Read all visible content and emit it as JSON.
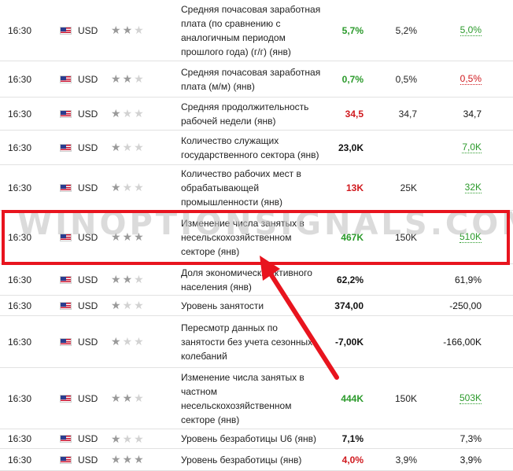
{
  "watermark": "WINOPTIONSIGNALS.COM",
  "colors": {
    "positive": "#2b9a2b",
    "negative": "#d0191e",
    "highlight": "#e8141e"
  },
  "rows": [
    {
      "time": "16:30",
      "currency": "USD",
      "stars": 2,
      "event": "Средняя почасовая заработная плата (по сравнению с аналогичным периодом прошлого года) (г/г) (янв)",
      "actual": "5,7%",
      "actual_color": "green",
      "forecast": "5,2%",
      "previous": "5,0%",
      "previous_color": "green",
      "previous_dotted": true
    },
    {
      "time": "16:30",
      "currency": "USD",
      "stars": 2,
      "event": "Средняя почасовая заработная плата (м/м) (янв)",
      "actual": "0,7%",
      "actual_color": "green",
      "forecast": "0,5%",
      "previous": "0,5%",
      "previous_color": "red",
      "previous_dotted": true
    },
    {
      "time": "16:30",
      "currency": "USD",
      "stars": 1,
      "event": "Средняя продолжительность рабочей недели (янв)",
      "actual": "34,5",
      "actual_color": "red",
      "forecast": "34,7",
      "previous": "34,7",
      "previous_color": "black",
      "previous_dotted": false
    },
    {
      "time": "16:30",
      "currency": "USD",
      "stars": 1,
      "event": "Количество служащих государственного сектора (янв)",
      "actual": "23,0K",
      "actual_color": "black",
      "forecast": "",
      "previous": "7,0K",
      "previous_color": "green",
      "previous_dotted": true
    },
    {
      "time": "16:30",
      "currency": "USD",
      "stars": 1,
      "event": "Количество рабочих мест в обрабатывающей промышленности (янв)",
      "actual": "13K",
      "actual_color": "red",
      "forecast": "25K",
      "previous": "32K",
      "previous_color": "green",
      "previous_dotted": true
    },
    {
      "time": "16:30",
      "currency": "USD",
      "stars": 3,
      "event": "Изменение числа занятых в несельскохозяйственном секторе (янв)",
      "actual": "467K",
      "actual_color": "green",
      "forecast": "150K",
      "previous": "510K",
      "previous_color": "green",
      "previous_dotted": true
    },
    {
      "time": "16:30",
      "currency": "USD",
      "stars": 2,
      "event": "Доля экономически активного населения (янв)",
      "actual": "62,2%",
      "actual_color": "black",
      "forecast": "",
      "previous": "61,9%",
      "previous_color": "black",
      "previous_dotted": false
    },
    {
      "time": "16:30",
      "currency": "USD",
      "stars": 1,
      "event": "Уровень занятости",
      "actual": "374,00",
      "actual_color": "black",
      "forecast": "",
      "previous": "-250,00",
      "previous_color": "black",
      "previous_dotted": false
    },
    {
      "time": "16:30",
      "currency": "USD",
      "stars": 1,
      "event": "Пересмотр данных по занятости без учета сезонных колебаний",
      "actual": "-7,00K",
      "actual_color": "black",
      "forecast": "",
      "previous": "-166,00K",
      "previous_color": "black",
      "previous_dotted": false
    },
    {
      "time": "16:30",
      "currency": "USD",
      "stars": 2,
      "event": "Изменение числа занятых в частном несельскохозяйственном секторе (янв)",
      "actual": "444K",
      "actual_color": "green",
      "forecast": "150K",
      "previous": "503K",
      "previous_color": "green",
      "previous_dotted": true
    },
    {
      "time": "16:30",
      "currency": "USD",
      "stars": 1,
      "event": "Уровень безработицы U6 (янв)",
      "actual": "7,1%",
      "actual_color": "black",
      "forecast": "",
      "previous": "7,3%",
      "previous_color": "black",
      "previous_dotted": false
    },
    {
      "time": "16:30",
      "currency": "USD",
      "stars": 3,
      "event": "Уровень безработицы (янв)",
      "actual": "4,0%",
      "actual_color": "red",
      "forecast": "3,9%",
      "previous": "3,9%",
      "previous_color": "black",
      "previous_dotted": false
    }
  ]
}
